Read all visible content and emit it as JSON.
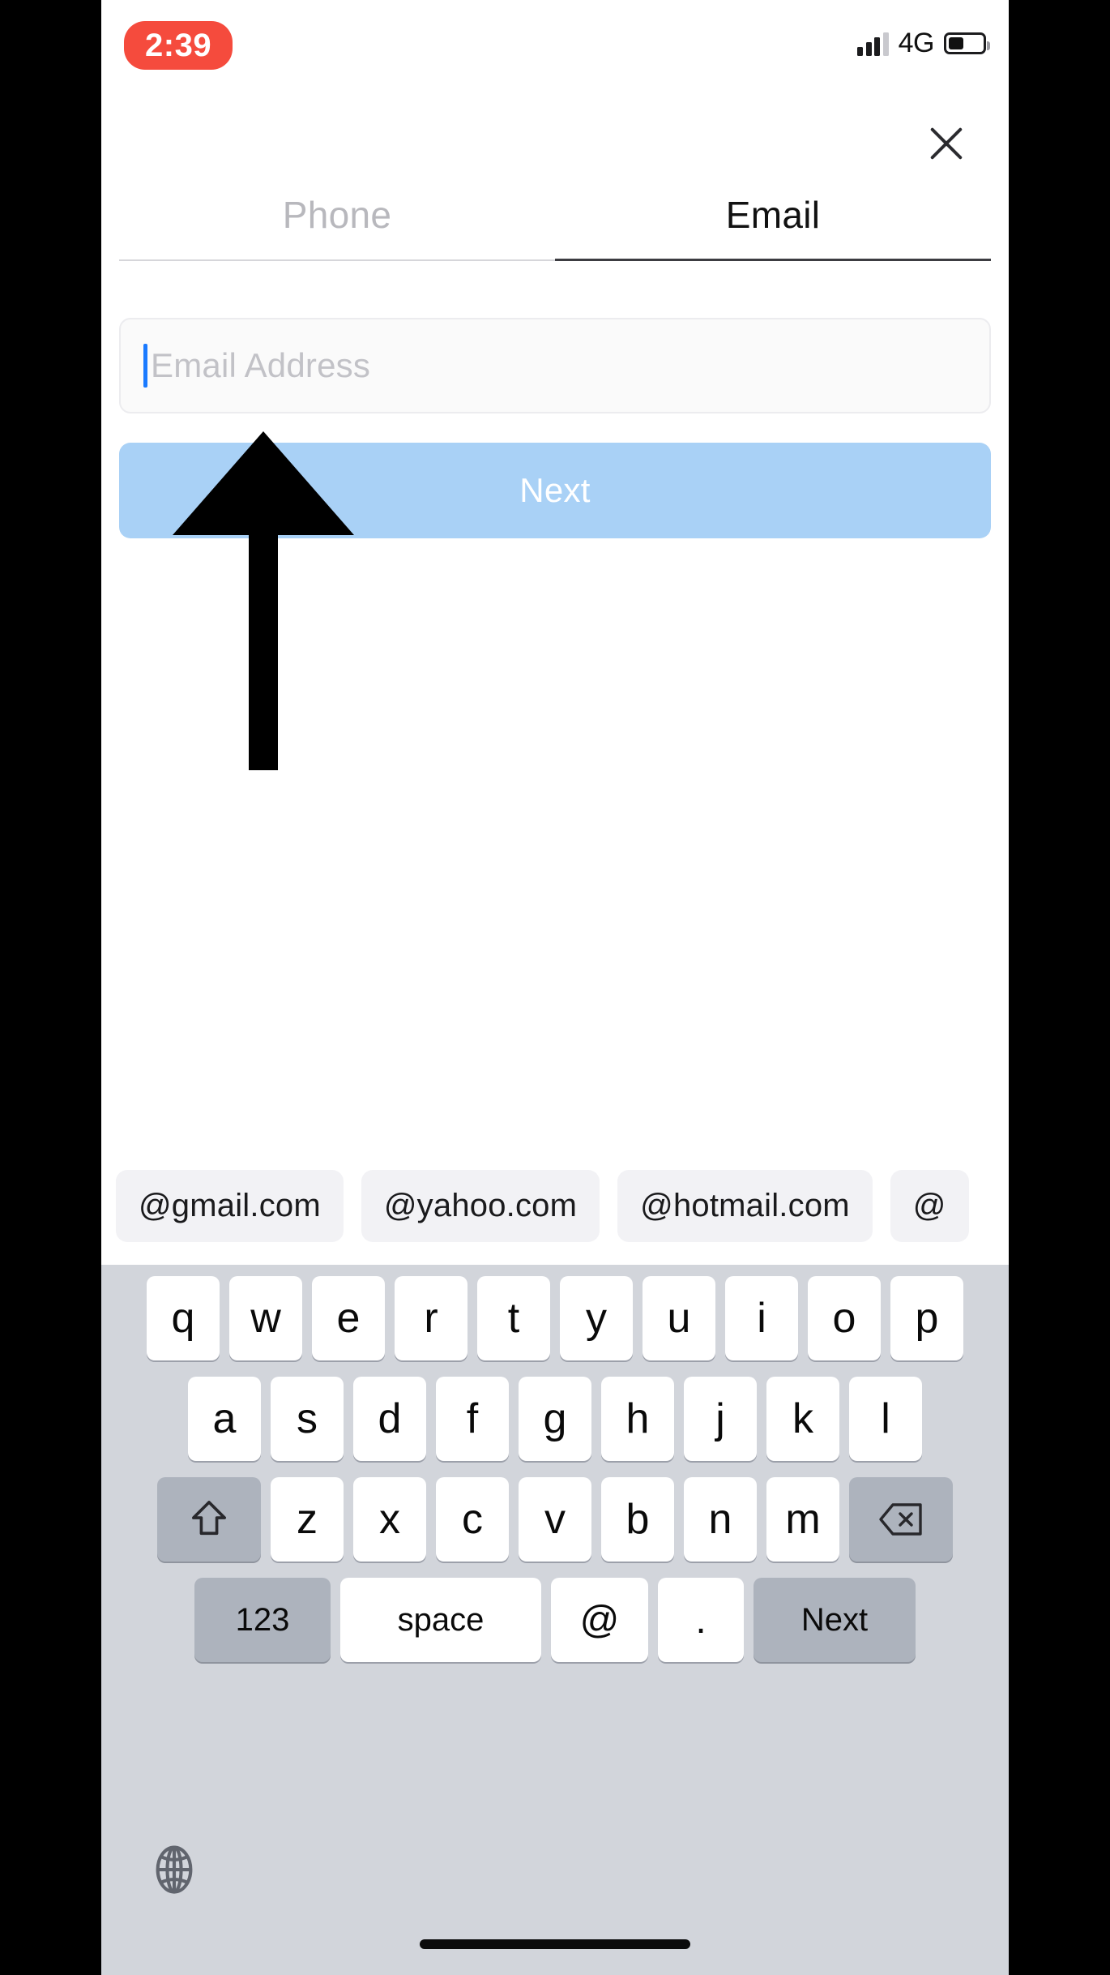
{
  "status_bar": {
    "time": "2:39",
    "time_pill_color": "#f54b3d",
    "network": "4G",
    "signal_bars_filled": 3,
    "signal_bars_total": 4,
    "battery_level_percent": 40,
    "icons": {
      "signal": "signal-bars-icon",
      "battery": "battery-icon"
    }
  },
  "header": {
    "close_icon": "close-icon"
  },
  "tabs": [
    {
      "label": "Phone",
      "active": false
    },
    {
      "label": "Email",
      "active": true
    }
  ],
  "form": {
    "email_input": {
      "placeholder": "Email Address",
      "value": "",
      "caret_color": "#1a7aff"
    },
    "next_button": {
      "label": "Next",
      "background": "#a9d1f6",
      "text_color": "#ffffff"
    }
  },
  "annotation": {
    "type": "arrow",
    "direction": "up",
    "color": "#000000",
    "points_to": "email-input-field"
  },
  "suggestions": [
    "@gmail.com",
    "@yahoo.com",
    "@hotmail.com",
    "@"
  ],
  "keyboard": {
    "background": "#d2d5db",
    "row1": [
      "q",
      "w",
      "e",
      "r",
      "t",
      "y",
      "u",
      "i",
      "o",
      "p"
    ],
    "row2": [
      "a",
      "s",
      "d",
      "f",
      "g",
      "h",
      "j",
      "k",
      "l"
    ],
    "row3": {
      "shift_icon": "shift-arrow-icon",
      "letters": [
        "z",
        "x",
        "c",
        "v",
        "b",
        "n",
        "m"
      ],
      "backspace_icon": "backspace-icon"
    },
    "row4": {
      "numbers_label": "123",
      "space_label": "space",
      "at_label": "@",
      "period_label": ".",
      "return_label": "Next"
    },
    "globe_icon": "globe-icon",
    "home_indicator": "home-indicator"
  }
}
